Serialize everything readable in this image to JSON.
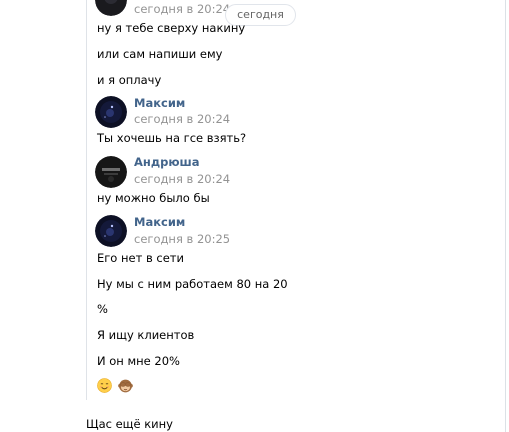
{
  "date_badge": "сегодня",
  "messages": [
    {
      "time": "сегодня в 20:24",
      "lines": [
        "ну я тебе сверху накину",
        "или сам напиши ему",
        "и я оплачу"
      ]
    },
    {
      "sender": "Максим",
      "time": "сегодня в 20:24",
      "lines": [
        "Ты хочешь на гсе взять?"
      ]
    },
    {
      "sender": "Андрюша",
      "time": "сегодня в 20:24",
      "lines": [
        "ну можно было бы"
      ]
    },
    {
      "sender": "Максим",
      "time": "сегодня в 20:25",
      "lines": [
        "Его нет в сети",
        "Ну мы с ним работаем 80 на 20",
        "%",
        "Я ищу клиентов",
        "И он мне 20%"
      ],
      "emojis": [
        "smiling-face-emoji",
        "see-no-evil-monkey-emoji"
      ]
    }
  ],
  "composer_draft": "Щас ещё кину",
  "colors": {
    "sender_name": "#42648b",
    "timestamp": "#939393",
    "divider": "#dce1e6"
  }
}
